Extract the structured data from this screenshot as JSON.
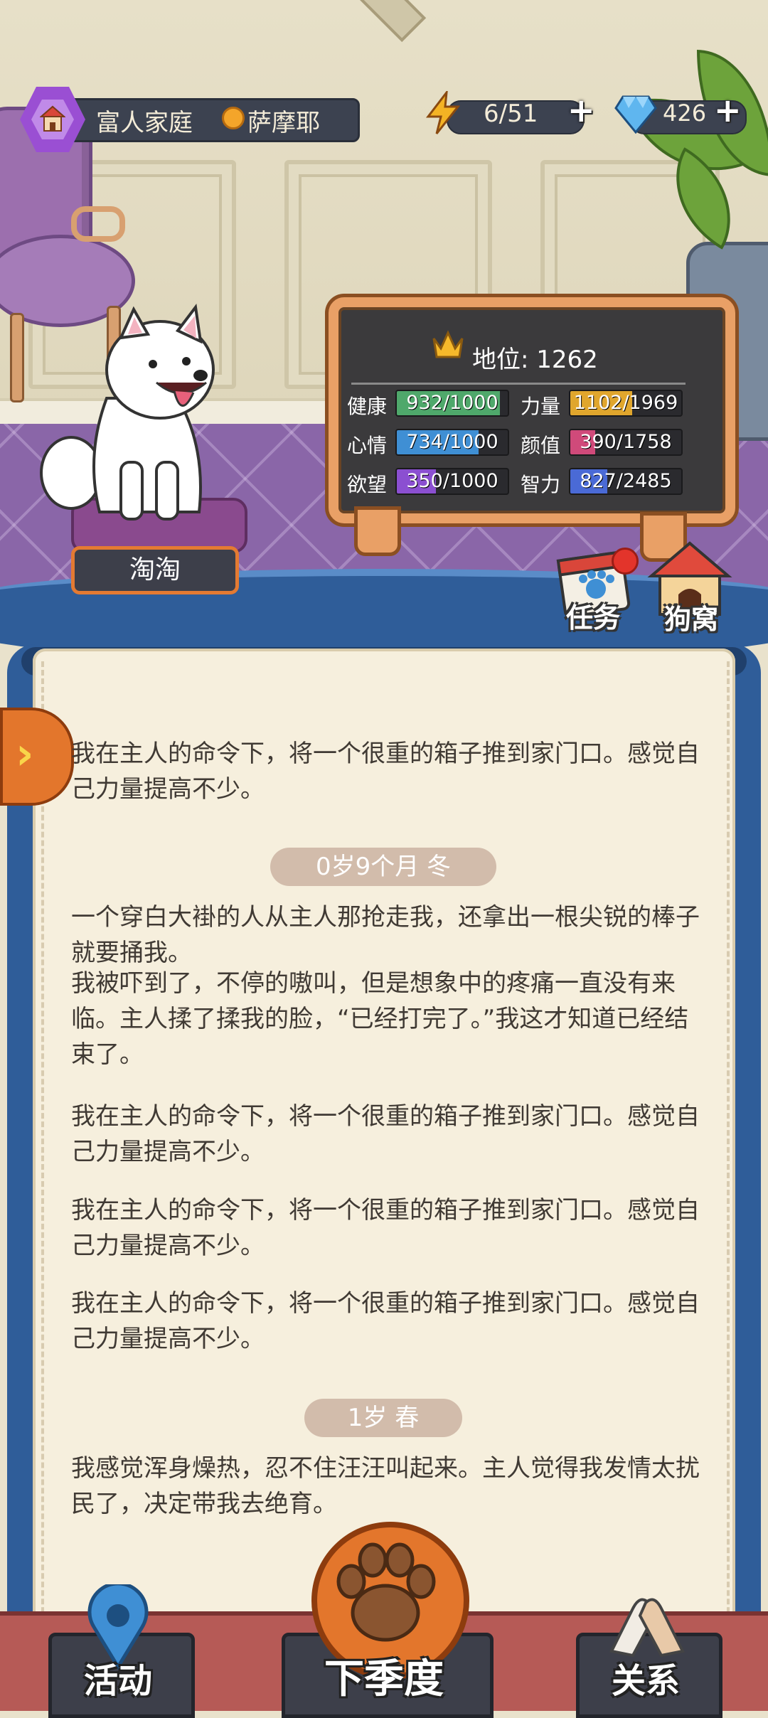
{
  "header": {
    "family_type": "富人家庭",
    "breed": "萨摩耶",
    "energy": "6/51",
    "gems": "426"
  },
  "dog": {
    "name": "淘淘"
  },
  "stats": {
    "status_label": "地位: 1262",
    "items": [
      {
        "label": "健康",
        "value": "932/1000",
        "fraction": 0.932,
        "color": "#4fa86b"
      },
      {
        "label": "力量",
        "value": "1102/1969",
        "fraction": 0.56,
        "color": "#e0a62d"
      },
      {
        "label": "心情",
        "value": "734/1000",
        "fraction": 0.734,
        "color": "#3f8fd4"
      },
      {
        "label": "颜值",
        "value": "390/1758",
        "fraction": 0.222,
        "color": "#d04a7a"
      },
      {
        "label": "欲望",
        "value": "350/1000",
        "fraction": 0.35,
        "color": "#8b4fd1"
      },
      {
        "label": "智力",
        "value": "827/2485",
        "fraction": 0.333,
        "color": "#4a6ad6"
      }
    ]
  },
  "side_buttons": {
    "tasks": "任务",
    "kennel": "狗窝"
  },
  "story": {
    "p1": "我在主人的命令下，将一个很重的箱子推到家门口。感觉自己力量提高不少。",
    "season1": "0岁9个月 冬",
    "p2": "一个穿白大褂的人从主人那抢走我，还拿出一根尖锐的棒子就要捅我。",
    "p3": "我被吓到了，不停的嗷叫，但是想象中的疼痛一直没有来临。主人揉了揉我的脸，“已经打完了。”我这才知道已经结束了。",
    "p4": "我在主人的命令下，将一个很重的箱子推到家门口。感觉自己力量提高不少。",
    "p5": "我在主人的命令下，将一个很重的箱子推到家门口。感觉自己力量提高不少。",
    "p6": "我在主人的命令下，将一个很重的箱子推到家门口。感觉自己力量提高不少。",
    "season2": "1岁 春",
    "p7": "我感觉浑身燥热，忍不住汪汪叫起来。主人觉得我发情太扰民了，决定带我去绝育。"
  },
  "nav": {
    "activity": "活动",
    "next_season": "下季度",
    "relations": "关系"
  }
}
